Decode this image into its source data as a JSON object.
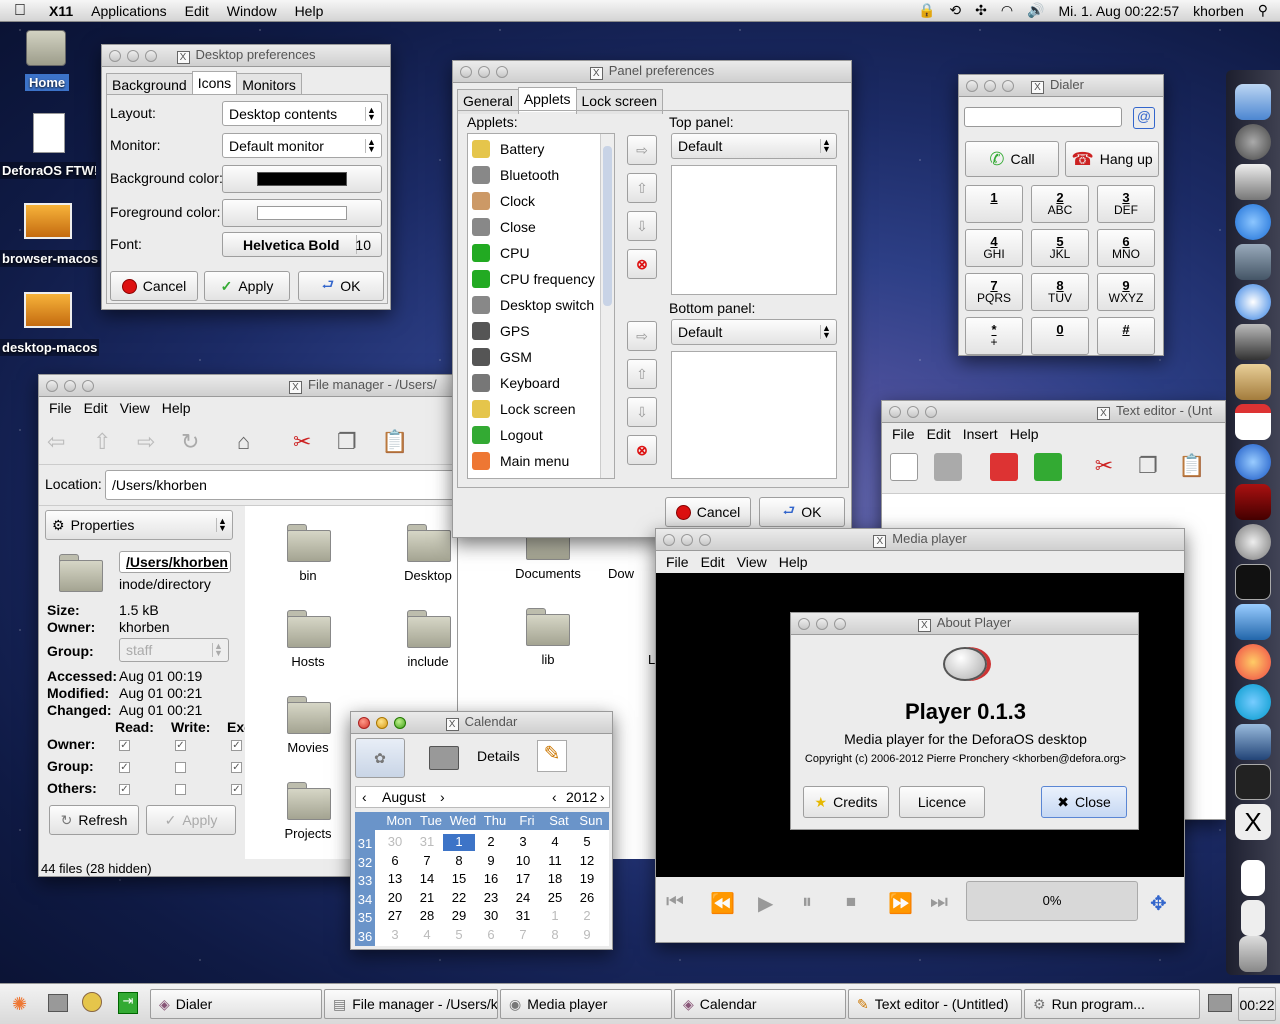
{
  "menubar": {
    "app": "X11",
    "items": [
      "Applications",
      "Edit",
      "Window",
      "Help"
    ],
    "clock": "Mi. 1. Aug  00:22:57",
    "user": "khorben"
  },
  "desktop_icons": [
    {
      "label": "Home"
    },
    {
      "label": "DeforaOS FTW!"
    },
    {
      "label": "browser-macos"
    },
    {
      "label": "desktop-macos"
    }
  ],
  "desktop_prefs": {
    "title": "Desktop preferences",
    "tabs": [
      "Background",
      "Icons",
      "Monitors"
    ],
    "layout_label": "Layout:",
    "layout_value": "Desktop contents",
    "monitor_label": "Monitor:",
    "monitor_value": "Default monitor",
    "bg_label": "Background color:",
    "fg_label": "Foreground color:",
    "font_label": "Font:",
    "font_value": "Helvetica Bold",
    "font_size": "10",
    "cancel": "Cancel",
    "apply": "Apply",
    "ok": "OK",
    "bg_color": "#000000",
    "fg_color": "#ffffff"
  },
  "panel_prefs": {
    "title": "Panel preferences",
    "tabs": [
      "General",
      "Applets",
      "Lock screen"
    ],
    "applets_label": "Applets:",
    "applets": [
      "Battery",
      "Bluetooth",
      "Clock",
      "Close",
      "CPU",
      "CPU frequency",
      "Desktop switch",
      "GPS",
      "GSM",
      "Keyboard",
      "Lock screen",
      "Logout",
      "Main menu"
    ],
    "top_label": "Top panel:",
    "top_value": "Default",
    "bottom_label": "Bottom panel:",
    "bottom_value": "Default",
    "cancel": "Cancel",
    "ok": "OK"
  },
  "dialer": {
    "title": "Dialer",
    "call": "Call",
    "hangup": "Hang up",
    "keys": [
      {
        "d": "1",
        "l": ""
      },
      {
        "d": "2",
        "l": "ABC"
      },
      {
        "d": "3",
        "l": "DEF"
      },
      {
        "d": "4",
        "l": "GHI"
      },
      {
        "d": "5",
        "l": "JKL"
      },
      {
        "d": "6",
        "l": "MNO"
      },
      {
        "d": "7",
        "l": "PQRS"
      },
      {
        "d": "8",
        "l": "TUV"
      },
      {
        "d": "9",
        "l": "WXYZ"
      },
      {
        "d": "*",
        "l": "+"
      },
      {
        "d": "0",
        "l": ""
      },
      {
        "d": "#",
        "l": ""
      }
    ]
  },
  "file_manager": {
    "title": "File manager - /Users/",
    "menu": [
      "File",
      "Edit",
      "View",
      "Help"
    ],
    "location_label": "Location:",
    "location_value": "/Users/khorben",
    "properties": "Properties",
    "name": "/Users/khorben",
    "type": "inode/directory",
    "size_label": "Size:",
    "size": "1.5 kB",
    "owner_label": "Owner:",
    "owner": "khorben",
    "group_label": "Group:",
    "group": "staff",
    "accessed_label": "Accessed:",
    "accessed": "Aug 01 00:19",
    "modified_label": "Modified:",
    "modified": "Aug 01 00:21",
    "changed_label": "Changed:",
    "changed": "Aug 01 00:21",
    "read": "Read:",
    "write": "Write:",
    "exec": "Exe",
    "perm_owner": "Owner:",
    "perm_group": "Group:",
    "perm_others": "Others:",
    "refresh": "Refresh",
    "apply": "Apply",
    "status": "44 files (28 hidden)",
    "files": [
      "bin",
      "Desktop",
      "Documents",
      "Dow",
      "Hosts",
      "include",
      "lib",
      "L",
      "Movies",
      "Projects"
    ]
  },
  "text_editor": {
    "title": "Text editor - (Unt",
    "menu": [
      "File",
      "Edit",
      "Insert",
      "Help"
    ]
  },
  "calendar": {
    "title": "Calendar",
    "details": "Details",
    "month": "August",
    "year": "2012",
    "weekdays": [
      "Mon",
      "Tue",
      "Wed",
      "Thu",
      "Fri",
      "Sat",
      "Sun"
    ],
    "weeks": [
      "31",
      "32",
      "33",
      "34",
      "35",
      "36"
    ],
    "days": [
      [
        "30",
        "31",
        "1",
        "2",
        "3",
        "4",
        "5"
      ],
      [
        "6",
        "7",
        "8",
        "9",
        "10",
        "11",
        "12"
      ],
      [
        "13",
        "14",
        "15",
        "16",
        "17",
        "18",
        "19"
      ],
      [
        "20",
        "21",
        "22",
        "23",
        "24",
        "25",
        "26"
      ],
      [
        "27",
        "28",
        "29",
        "30",
        "31",
        "1",
        "2"
      ],
      [
        "3",
        "4",
        "5",
        "6",
        "7",
        "8",
        "9"
      ]
    ]
  },
  "media_player": {
    "title": "Media player",
    "menu": [
      "File",
      "Edit",
      "View",
      "Help"
    ],
    "progress": "0%"
  },
  "about": {
    "title": "About Player",
    "name": "Player 0.1.3",
    "desc": "Media player for the DeforaOS desktop",
    "copyright": "Copyright (c) 2006-2012 Pierre Pronchery <khorben@defora.org>",
    "credits": "Credits",
    "licence": "Licence",
    "close": "Close"
  },
  "taskbar": {
    "items": [
      "Dialer",
      "File manager - /Users/khc",
      "Media player",
      "Calendar",
      "Text editor - (Untitled)",
      "Run program..."
    ],
    "clock": "00:22"
  }
}
